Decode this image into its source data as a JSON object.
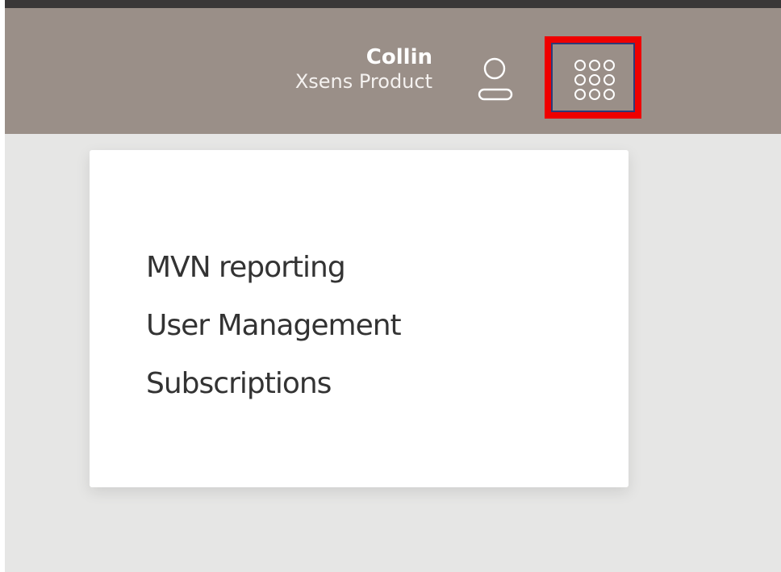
{
  "header": {
    "user_name": "Collin",
    "organization": "Xsens Product",
    "icons": {
      "profile": "user-icon",
      "apps": "app-grid-icon"
    }
  },
  "dropdown": {
    "items": [
      {
        "label": "MVN reporting"
      },
      {
        "label": "User Management"
      },
      {
        "label": "Subscriptions"
      }
    ]
  },
  "colors": {
    "header_bg": "#9a8f88",
    "page_bg": "#e6e6e5",
    "highlight": "#ef0000",
    "apps_border": "#2d3a78"
  }
}
